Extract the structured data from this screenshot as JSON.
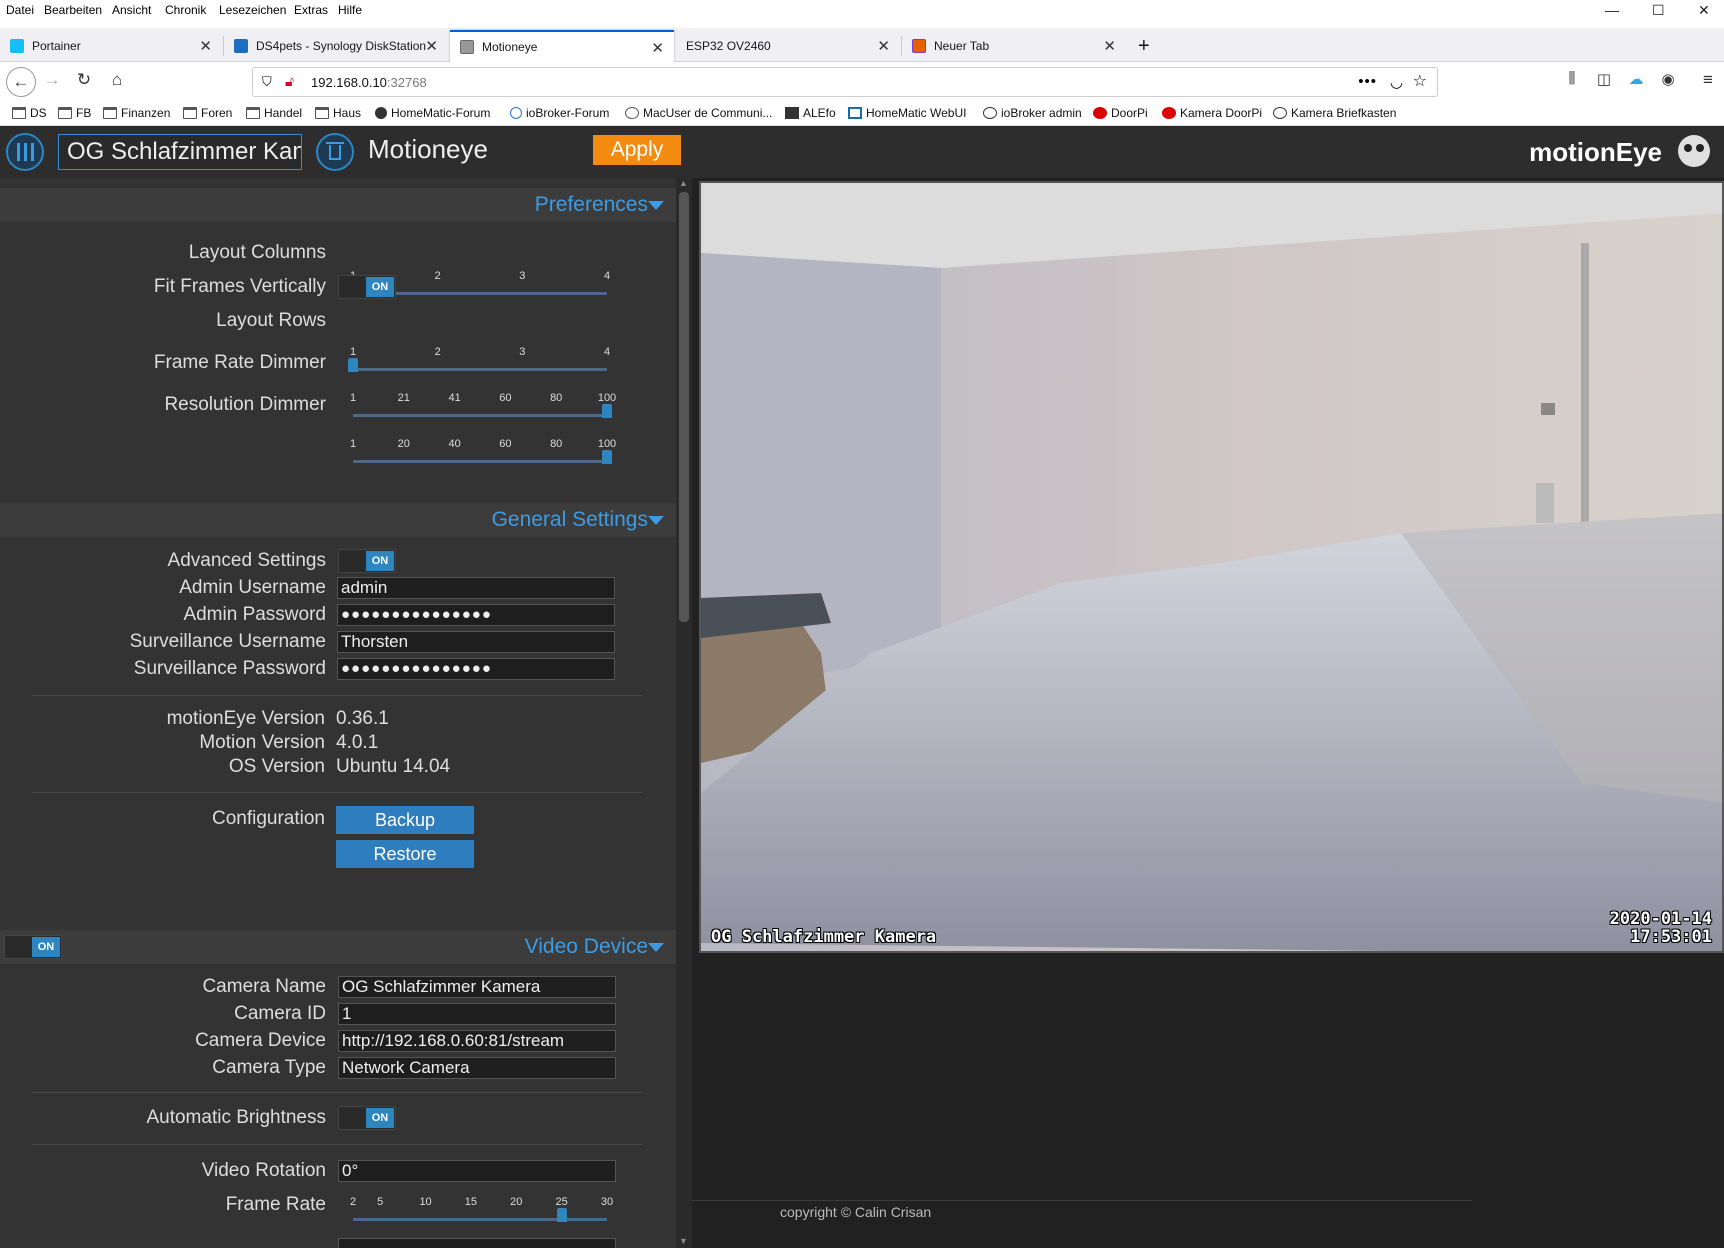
{
  "menu": [
    "Datei",
    "Bearbeiten",
    "Ansicht",
    "Chronik",
    "Lesezeichen",
    "Extras",
    "Hilfe"
  ],
  "tabs": [
    {
      "label": "Portainer",
      "color": "#13bef9"
    },
    {
      "label": "DS4pets - Synology DiskStation",
      "color": "#1d6ebf"
    },
    {
      "label": "Motioneye",
      "color": "#777777"
    },
    {
      "label": "ESP32 OV2460",
      "color": ""
    },
    {
      "label": "Neuer Tab",
      "color": "#e66000"
    }
  ],
  "url": {
    "host": "192.168.0.10",
    "port": ":32768"
  },
  "bookmarks": [
    "DS",
    "FB",
    "Finanzen",
    "Foren",
    "Handel",
    "Haus",
    "HomeMatic-Forum",
    "ioBroker-Forum",
    "MacUser de Communi...",
    "ALEfo",
    "HomeMatic WebUI",
    "ioBroker admin",
    "DoorPi",
    "Kamera DoorPi",
    "Kamera Briefkasten"
  ],
  "app": {
    "camera_select": "OG Schlafzimmer Kamera",
    "camera_label": "Motioneye",
    "apply": "Apply",
    "brand": "motionEye"
  },
  "preferences": {
    "title": "Preferences",
    "layout_columns": {
      "label": "Layout Columns",
      "ticks": [
        "1",
        "2",
        "3",
        "4"
      ],
      "value_fraction": 0
    },
    "fit_frames": {
      "label": "Fit Frames Vertically",
      "state": "ON"
    },
    "layout_rows": {
      "label": "Layout Rows",
      "ticks": [
        "1",
        "2",
        "3",
        "4"
      ],
      "value_fraction": 0
    },
    "frame_rate_dimmer": {
      "label": "Frame Rate Dimmer",
      "ticks": [
        "1",
        "21",
        "41",
        "60",
        "80",
        "100"
      ],
      "value_fraction": 1
    },
    "resolution_dimmer": {
      "label": "Resolution Dimmer",
      "ticks": [
        "1",
        "20",
        "40",
        "60",
        "80",
        "100"
      ],
      "value_fraction": 1
    }
  },
  "general": {
    "title": "General Settings",
    "advanced": {
      "label": "Advanced Settings",
      "state": "ON"
    },
    "admin_user": {
      "label": "Admin Username",
      "value": "admin"
    },
    "admin_pass": {
      "label": "Admin Password",
      "value": "●●●●●●●●●●●●●●●"
    },
    "surv_user": {
      "label": "Surveillance Username",
      "value": "Thorsten"
    },
    "surv_pass": {
      "label": "Surveillance Password",
      "value": "●●●●●●●●●●●●●●●"
    },
    "motioneye_version": {
      "label": "motionEye Version",
      "value": "0.36.1"
    },
    "motion_version": {
      "label": "Motion Version",
      "value": "4.0.1"
    },
    "os_version": {
      "label": "OS Version",
      "value": "Ubuntu 14.04"
    },
    "configuration": {
      "label": "Configuration",
      "backup": "Backup",
      "restore": "Restore"
    }
  },
  "video": {
    "title": "Video Device",
    "enabled": "ON",
    "camera_name": {
      "label": "Camera Name",
      "value": "OG Schlafzimmer Kamera"
    },
    "camera_id": {
      "label": "Camera ID",
      "value": "1"
    },
    "camera_device": {
      "label": "Camera Device",
      "value": "http://192.168.0.60:81/stream"
    },
    "camera_type": {
      "label": "Camera Type",
      "value": "Network Camera"
    },
    "auto_brightness": {
      "label": "Automatic Brightness",
      "state": "ON"
    },
    "rotation": {
      "label": "Video Rotation",
      "value": "0°"
    },
    "frame_rate": {
      "label": "Frame Rate",
      "ticks": [
        "2",
        "5",
        "10",
        "15",
        "20",
        "25",
        "30"
      ],
      "value": 25
    }
  },
  "camera": {
    "osd_name": "OG Schlafzimmer Kamera",
    "osd_date": "2020-01-14",
    "osd_time": "17:53:01"
  },
  "footer": {
    "copyright": "copyright © Calin Crisan"
  }
}
